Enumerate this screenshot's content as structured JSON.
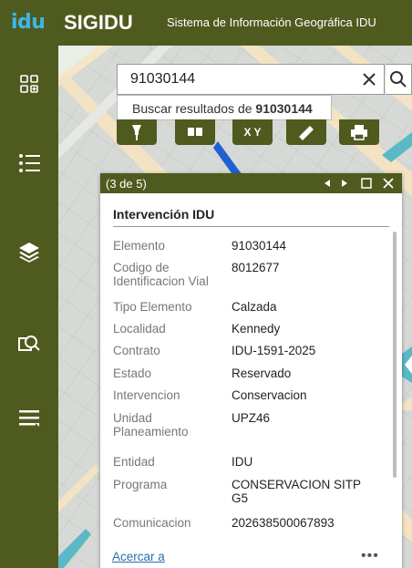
{
  "header": {
    "logo": "idu",
    "app_name": "SIGIDU",
    "subtitle": "Sistema de Información Geográfica IDU"
  },
  "left_toolbar": {
    "icons": [
      "widgets-icon",
      "list-icon",
      "layers-icon",
      "query-icon",
      "menu-icon"
    ]
  },
  "search": {
    "value": "91030144",
    "suggestion_prefix": "Buscar resultados de ",
    "suggestion_term": "91030144"
  },
  "map_tools": {
    "coordinates_label": "X Y"
  },
  "popup": {
    "counter": "(3 de 5)",
    "title": "Intervención IDU",
    "rows": [
      {
        "label": "Elemento",
        "value": "91030144"
      },
      {
        "label": "Codigo de Identificacion Vial",
        "value": "8012677"
      },
      {
        "label": "Tipo Elemento",
        "value": "Calzada"
      },
      {
        "label": "Localidad",
        "value": "Kennedy"
      },
      {
        "label": "Contrato",
        "value": "IDU-1591-2025"
      },
      {
        "label": "Estado",
        "value": "Reservado"
      },
      {
        "label": "Intervencion",
        "value": "Conservacion"
      },
      {
        "label": "Unidad Planeamiento",
        "value": "UPZ46"
      },
      {
        "label": "Entidad",
        "value": "IDU"
      },
      {
        "label": "Programa",
        "value": "CONSERVACION SITP G5"
      },
      {
        "label": "Comunicacion",
        "value": "202638500067893"
      }
    ],
    "footer_link": "Acercar a",
    "more": "•••"
  },
  "colors": {
    "brand_dark": "#4f5a1e",
    "logo": "#3ab8e6",
    "link": "#2b6cb0"
  }
}
